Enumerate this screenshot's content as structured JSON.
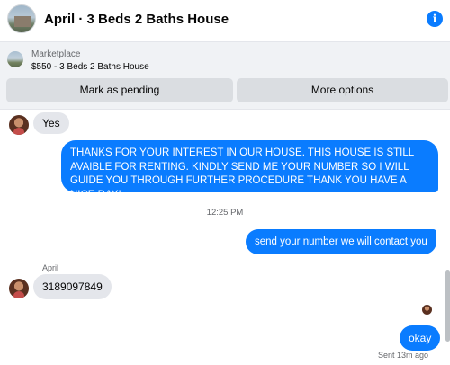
{
  "header": {
    "title": "April · 3 Beds 2 Baths House",
    "avatar_icon": "house-photo-icon",
    "info_icon": "info-icon",
    "info_glyph": "i"
  },
  "marketplace": {
    "kicker": "Marketplace",
    "listing": "$550 - 3 Beds 2 Baths House",
    "mark_pending_label": "Mark as pending",
    "more_options_label": "More options"
  },
  "messages": [
    {
      "from": "April",
      "text": "Yes"
    },
    {
      "from": "me",
      "text": "THANKS FOR YOUR INTEREST IN OUR HOUSE. THIS HOUSE IS STILL AVAIBLE FOR RENTING. KINDLY SEND ME YOUR NUMBER SO I WILL GUIDE YOU THROUGH FURTHER PROCEDURE THANK YOU HAVE A NICE DAY!"
    },
    {
      "from": "me",
      "text": "send your number we will contact you"
    },
    {
      "from": "April",
      "text": "3189097849"
    },
    {
      "from": "me",
      "text": "okay"
    }
  ],
  "timestamp": "12:25 PM",
  "sender_name": "April",
  "sent_status": "Sent 13m ago",
  "colors": {
    "accent": "#0a7cff",
    "incoming_bubble": "#e4e6eb",
    "panel_bg": "#f0f2f5"
  }
}
